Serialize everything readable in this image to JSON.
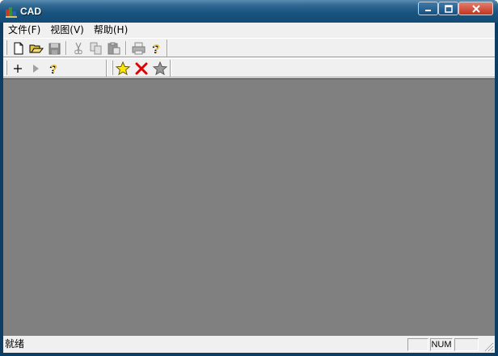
{
  "window": {
    "title": "CAD"
  },
  "menu": {
    "items": [
      {
        "label": "文件(F)"
      },
      {
        "label": "视图(V)"
      },
      {
        "label": "帮助(H)"
      }
    ]
  },
  "toolbar_main": {
    "buttons": [
      {
        "icon": "new-document-icon"
      },
      {
        "icon": "open-folder-icon"
      },
      {
        "icon": "save-icon"
      },
      {
        "icon": "cut-icon"
      },
      {
        "icon": "copy-icon"
      },
      {
        "icon": "paste-icon"
      },
      {
        "icon": "print-icon"
      },
      {
        "icon": "help-context-icon"
      }
    ]
  },
  "toolbar_secondary": {
    "buttons": [
      {
        "icon": "plus-icon"
      },
      {
        "icon": "play-arrow-icon"
      },
      {
        "icon": "help-context-icon"
      },
      {
        "icon": "star-yellow-icon"
      },
      {
        "icon": "red-x-icon"
      },
      {
        "icon": "star-gray-icon"
      }
    ]
  },
  "status": {
    "text": "就绪",
    "num_indicator": "NUM",
    "cap_indicator": "",
    "scrl_indicator": ""
  },
  "colors": {
    "titlebar": "#1a557f",
    "workspace": "#808080",
    "close_button": "#c2351e"
  }
}
